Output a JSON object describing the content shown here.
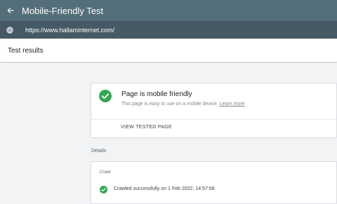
{
  "header": {
    "title": "Mobile-Friendly Test",
    "back_icon": "back-arrow-icon"
  },
  "url_bar": {
    "url": "https://www.hallaminternet.com/",
    "icon": "globe-icon"
  },
  "results": {
    "title": "Test results"
  },
  "verdict": {
    "title": "Page is mobile friendly",
    "description": "This page is easy to use on a mobile device.",
    "learn_more": "Learn more",
    "view_button": "VIEW TESTED PAGE",
    "status_color": "#34a853"
  },
  "details": {
    "label": "Details",
    "crawl": {
      "label": "Crawl",
      "status": "Crawled successfully on 1 Feb 2022, 14:57:58",
      "status_color": "#34a853"
    }
  },
  "colors": {
    "topbar": "#546e7a",
    "urlbar": "#455a64",
    "background": "#f1f3f4"
  }
}
